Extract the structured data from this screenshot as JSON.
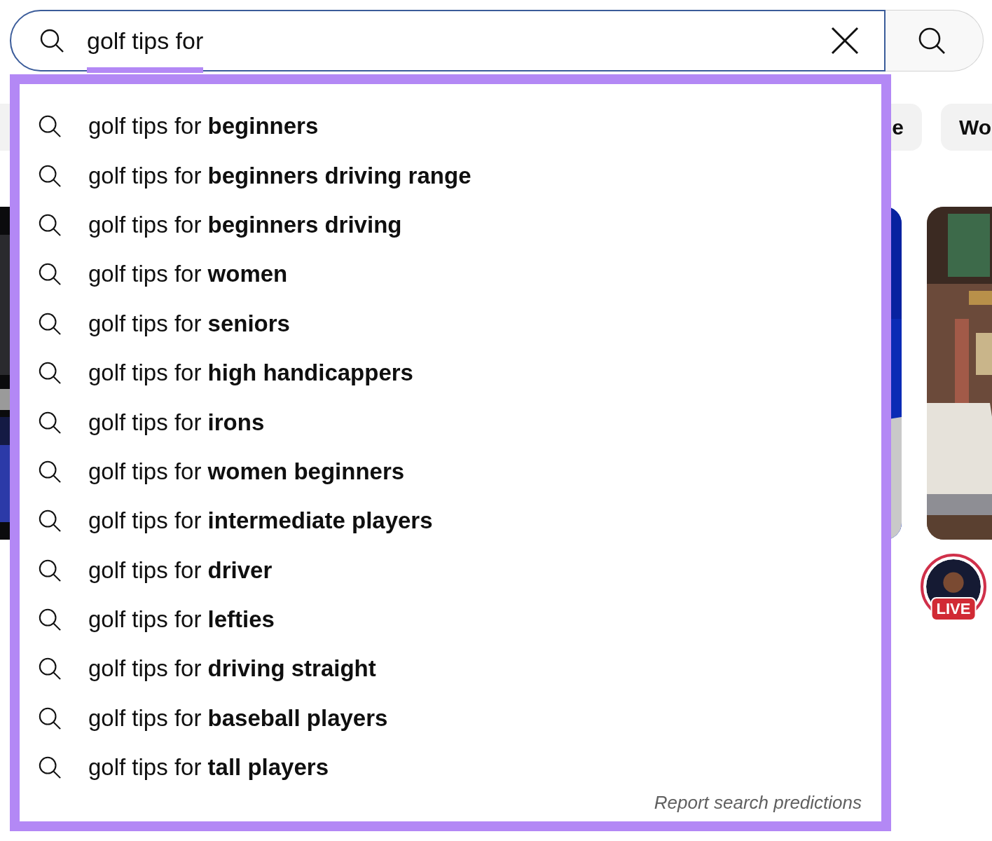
{
  "search": {
    "value": "golf tips for"
  },
  "suggestions": [
    {
      "text": "golf tips for **beginners**"
    },
    {
      "text": "golf tips for **beginners driving range**"
    },
    {
      "text": "golf tips for **beginners driving**"
    },
    {
      "text": "golf tips for **women**"
    },
    {
      "text": "golf tips for **seniors**"
    },
    {
      "text": "golf tips for **high handicappers**"
    },
    {
      "text": "golf tips for **irons**"
    },
    {
      "text": "golf tips for **women beginners**"
    },
    {
      "text": "golf tips for **intermediate players**"
    },
    {
      "text": "golf tips for **driver**"
    },
    {
      "text": "golf tips for **lefties**"
    },
    {
      "text": "golf tips for **driving straight**"
    },
    {
      "text": "golf tips for **baseball players**"
    },
    {
      "text": "golf tips for **tall players**"
    }
  ],
  "report_link": "Report search predictions",
  "background": {
    "chips": [
      "e",
      "Wo"
    ],
    "live_badge": "LIVE"
  }
}
